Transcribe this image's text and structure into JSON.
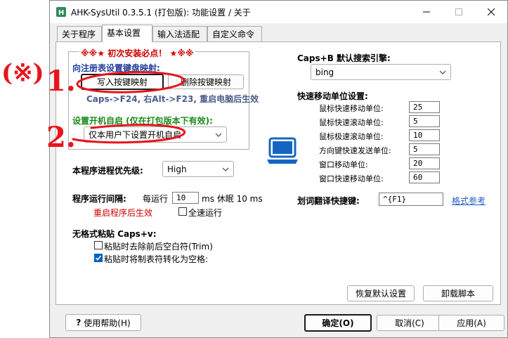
{
  "window": {
    "title": "AHK-SysUtil 0.3.5.1 (打包版): 功能设置 / 关于"
  },
  "tabs": [
    {
      "label": "关于程序"
    },
    {
      "label": "基本设置"
    },
    {
      "label": "输入法适配"
    },
    {
      "label": "自定义命令"
    }
  ],
  "left": {
    "notice": "※※★  初次安装必点！ ★※※",
    "registry_group_label": "向注册表设置键盘映射:",
    "write_map_button": "写入按键映射",
    "delete_map_button": "删除按键映射",
    "map_hint": "Caps->F24, 右Alt->F23, 重启电脑后生效",
    "autostart_label": "设置开机自启 (仅在打包版本下有效):",
    "autostart_value": "仅本用户下设置开机自启",
    "priority_label": "本程序进程优先级:",
    "priority_value": "High",
    "interval_label": "程序运行间隔:",
    "every_run_label": "每运行",
    "every_run_value": "10",
    "sleep_label": "ms 休眠 10 ms",
    "restart_hint": "重启程序后生效",
    "full_speed_label": "全速运行",
    "plain_paste_label": "无格式粘贴 Caps+v:",
    "trim_label": "粘贴时去除前后空白符(Trim)",
    "tab_to_space_label": "粘贴时将制表符转化为空格:"
  },
  "right": {
    "search_engine_label": "Caps+B 默认搜索引擎:",
    "search_engine_value": "bing",
    "move_unit_label": "快速移动单位设置:",
    "units": [
      {
        "label": "鼠标快速移动单位:",
        "value": "25"
      },
      {
        "label": "鼠标快速滚动单位:",
        "value": "5"
      },
      {
        "label": "鼠标极速滚动单位:",
        "value": "10"
      },
      {
        "label": "方向键快速发送单位:",
        "value": "5"
      },
      {
        "label": "窗口移动单位:",
        "value": "20"
      },
      {
        "label": "窗口快速移动单位:",
        "value": "60"
      }
    ],
    "translate_hotkey_label": "划词翻译快捷键:",
    "translate_hotkey_value": "^{F1}",
    "format_ref_link": "格式参考",
    "restore_defaults_button": "恢复默认设置",
    "uninstall_button": "卸载脚本"
  },
  "footer": {
    "help_button": "使用帮助(H)",
    "ok_button": "确定(O)",
    "cancel_button": "取消(C)",
    "apply_button": "应用(A)"
  },
  "annotations": {
    "mark": "(※)",
    "step1": "1.",
    "step2": "2."
  },
  "colors": {
    "annotation_red": "#e8141c",
    "link_blue": "#1f5fbf",
    "checkbox_blue": "#0060c0"
  }
}
